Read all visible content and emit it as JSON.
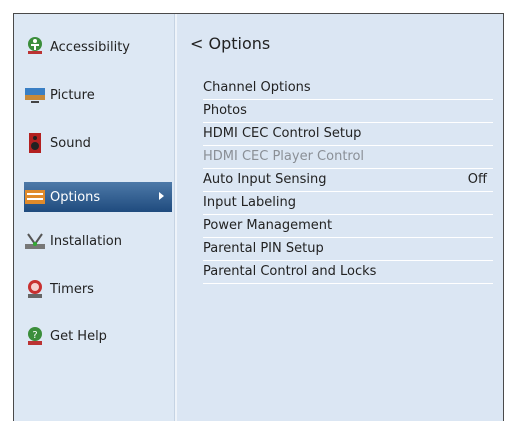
{
  "sidebar": {
    "items": [
      {
        "label": "Accessibility",
        "icon": "accessibility-icon"
      },
      {
        "label": "Picture",
        "icon": "picture-icon"
      },
      {
        "label": "Sound",
        "icon": "sound-icon"
      },
      {
        "label": "Options",
        "icon": "options-icon",
        "selected": true
      },
      {
        "label": "Installation",
        "icon": "installation-icon"
      },
      {
        "label": "Timers",
        "icon": "timers-icon"
      },
      {
        "label": "Get Help",
        "icon": "get-help-icon"
      }
    ]
  },
  "main": {
    "back_chevron": "<",
    "title": "Options",
    "items": [
      {
        "label": "Channel Options"
      },
      {
        "label": "Photos"
      },
      {
        "label": "HDMI CEC Control Setup"
      },
      {
        "label": "HDMI CEC Player Control",
        "disabled": true
      },
      {
        "label": "Auto Input Sensing",
        "value": "Off"
      },
      {
        "label": "Input Labeling"
      },
      {
        "label": "Power Management"
      },
      {
        "label": "Parental PIN Setup"
      },
      {
        "label": "Parental Control and Locks"
      }
    ]
  },
  "colors": {
    "selected_bg": "#2c5a8c",
    "panel_bg": "#dbe6f3",
    "disabled_text": "#8a8f96"
  }
}
